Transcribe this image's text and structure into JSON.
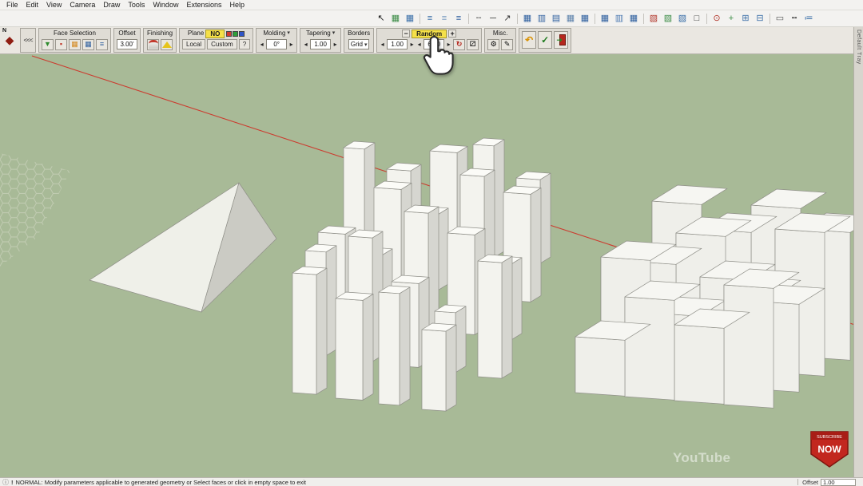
{
  "menu": {
    "items": [
      "File",
      "Edit",
      "View",
      "Camera",
      "Draw",
      "Tools",
      "Window",
      "Extensions",
      "Help"
    ]
  },
  "main_toolbar": {
    "icons": [
      {
        "name": "select-arrow-icon",
        "glyph": "↖",
        "color": "#1a1a1a"
      },
      {
        "name": "green-grid-icon",
        "glyph": "▦",
        "color": "#3c8c46"
      },
      {
        "name": "blue-grid-icon",
        "glyph": "▦",
        "color": "#3a6fa8"
      },
      {
        "divider": true
      },
      {
        "name": "justify-icon-1",
        "glyph": "≡",
        "color": "#3a6fa8"
      },
      {
        "name": "justify-icon-2",
        "glyph": "≡",
        "color": "#7a9cc0"
      },
      {
        "name": "justify-icon-3",
        "glyph": "≡",
        "color": "#2e5f9e"
      },
      {
        "divider": true
      },
      {
        "name": "dashed-line-icon",
        "glyph": "╌",
        "color": "#333333"
      },
      {
        "name": "solid-line-icon",
        "glyph": "─",
        "color": "#333333"
      },
      {
        "name": "diagonal-arrow-icon",
        "glyph": "↗",
        "color": "#333333"
      },
      {
        "divider": true
      },
      {
        "name": "table-icon-1",
        "glyph": "▦",
        "color": "#2e5f9e"
      },
      {
        "name": "table-icon-2",
        "glyph": "▥",
        "color": "#2e5f9e"
      },
      {
        "name": "table-icon-3",
        "glyph": "▤",
        "color": "#2e5f9e"
      },
      {
        "name": "table-icon-4",
        "glyph": "▦",
        "color": "#5d82ab"
      },
      {
        "name": "table-icon-5",
        "glyph": "▦",
        "color": "#2e5f9e"
      },
      {
        "divider": true
      },
      {
        "name": "table-icon-6",
        "glyph": "▦",
        "color": "#2e5f9e"
      },
      {
        "name": "table-icon-7",
        "glyph": "▥",
        "color": "#4a78b0"
      },
      {
        "name": "table-icon-8",
        "glyph": "▦",
        "color": "#2e5f9e"
      },
      {
        "divider": true
      },
      {
        "name": "box-red-icon",
        "glyph": "▧",
        "color": "#b2392e"
      },
      {
        "name": "box-green-icon",
        "glyph": "▧",
        "color": "#3c8c46"
      },
      {
        "name": "box-blue-icon",
        "glyph": "▧",
        "color": "#3a6fa8"
      },
      {
        "name": "selection-box-icon",
        "glyph": "□",
        "color": "#333333"
      },
      {
        "divider": true
      },
      {
        "name": "target-icon",
        "glyph": "⊙",
        "color": "#b2392e"
      },
      {
        "name": "axes-cross-icon",
        "glyph": "+",
        "color": "#3c8c46"
      },
      {
        "name": "grid-plus-icon",
        "glyph": "⊞",
        "color": "#3a6fa8"
      },
      {
        "name": "grid-minus-icon",
        "glyph": "⊟",
        "color": "#3a6fa8"
      },
      {
        "divider": true
      },
      {
        "name": "ruler-icon",
        "glyph": "▭",
        "color": "#555555"
      },
      {
        "name": "dash-style-icon",
        "glyph": "╍",
        "color": "#555555"
      },
      {
        "name": "list-icon",
        "glyph": "≔",
        "color": "#3a6fa8"
      }
    ]
  },
  "plugin_toolbar": {
    "plugin_initial": "N",
    "collapse_label": "<<<",
    "highlight_color": "#f5e049",
    "glyphs": {
      "spin_left": "◂",
      "spin_right": "▸",
      "caret": "▾",
      "undo": "↶",
      "confirm": "✓",
      "reroll": "↻",
      "dice": "⚂",
      "gear": "⚙",
      "pencil": "✎"
    },
    "face_selection": {
      "label": "Face Selection",
      "buttons": [
        {
          "name": "green-arrow-icon",
          "glyph": "▼",
          "color": "#2e8b2e"
        },
        {
          "name": "red-face-icon",
          "glyph": "▪",
          "color": "#c0392b"
        },
        {
          "name": "orange-grid-icon",
          "glyph": "▦",
          "color": "#d4881e"
        },
        {
          "name": "blue-grid-icon",
          "glyph": "▦",
          "color": "#2e5f9e"
        },
        {
          "name": "blue-lines-icon",
          "glyph": "≡",
          "color": "#2e5f9e"
        }
      ]
    },
    "offset": {
      "label": "Offset",
      "value": "3.00'"
    },
    "finishing": {
      "label": "Finishing"
    },
    "plane": {
      "label": "Plane",
      "none_label": "NO",
      "axis_locks": [
        {
          "name": "red-axis",
          "color": "#d03a2f"
        },
        {
          "name": "green-axis",
          "color": "#2f9e3a"
        },
        {
          "name": "blue-axis",
          "color": "#2f55c8"
        }
      ],
      "local_label": "Local",
      "custom_label": "Custom",
      "help_label": "?"
    },
    "molding": {
      "label": "Molding",
      "value": "0°"
    },
    "tapering": {
      "label": "Tapering",
      "value": "1.00"
    },
    "borders": {
      "label": "Borders",
      "value": "Grid"
    },
    "random": {
      "label": "Random",
      "minus": "−",
      "plus": "+",
      "value1": "1.00",
      "value2": "6.00"
    },
    "misc": {
      "label": "Misc."
    }
  },
  "tray": {
    "title": "Default Tray"
  },
  "status_bar": {
    "info_glyph": "ⓘ",
    "prefix": "!",
    "message": "NORMAL: Modify parameters applicable to generated geometry or Select faces or click in empty space to exit",
    "field_label": "Offset",
    "field_value": "1.00"
  },
  "watermark": {
    "text": "YouTube"
  },
  "subscribe": {
    "line1": "SUBSCRIBE",
    "line2": "NOW"
  },
  "colors": {
    "viewport_bg": "#a8ba97",
    "axis_red": "#cc3b2f"
  }
}
